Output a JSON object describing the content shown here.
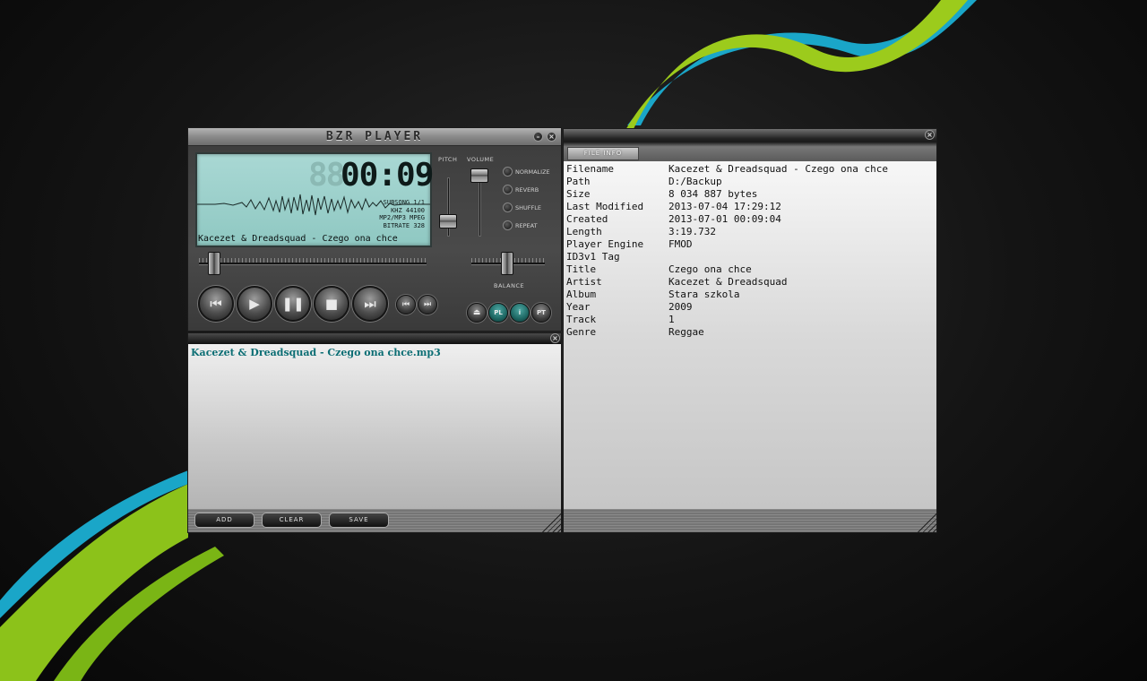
{
  "player": {
    "title": "BZR PLAYER",
    "lcd": {
      "time_ghost": "88",
      "time": "00:09",
      "info_lines": [
        "SUBSONG 1/1",
        "KHZ 44100",
        "MP2/MP3 MPEG",
        "BITRATE 328"
      ],
      "song": "Kacezet & Dreadsquad - Czego ona chce"
    },
    "labels": {
      "pitch": "PITCH",
      "volume": "VOLUME",
      "balance": "BALANCE"
    },
    "options": [
      "NORMALIZE",
      "REVERB",
      "SHUFFLE",
      "REPEAT"
    ],
    "small_buttons": {
      "playlist": "PL",
      "info": "i",
      "pt": "PT"
    }
  },
  "playlist": {
    "items": [
      "Kacezet & Dreadsquad - Czego ona chce.mp3"
    ],
    "buttons": {
      "add": "ADD",
      "clear": "CLEAR",
      "save": "SAVE"
    }
  },
  "file_info": {
    "tab": "FILE INFO",
    "rows": [
      {
        "key": "Filename",
        "value": "Kacezet & Dreadsquad - Czego ona chce"
      },
      {
        "key": "Path",
        "value": "D:/Backup"
      },
      {
        "key": "Size",
        "value": "8 034 887 bytes"
      },
      {
        "key": "Last Modified",
        "value": "2013-07-04 17:29:12"
      },
      {
        "key": "Created",
        "value": "2013-07-01 00:09:04"
      },
      {
        "key": "Length",
        "value": "3:19.732"
      },
      {
        "key": "Player Engine",
        "value": "FMOD"
      },
      {
        "key": "ID3v1 Tag",
        "value": ""
      },
      {
        "key": "Title",
        "value": "Czego ona chce"
      },
      {
        "key": "Artist",
        "value": "Kacezet & Dreadsquad"
      },
      {
        "key": "Album",
        "value": "Stara szkola"
      },
      {
        "key": "Year",
        "value": "2009"
      },
      {
        "key": "Track",
        "value": "1"
      },
      {
        "key": "Genre",
        "value": "Reggae"
      }
    ]
  },
  "colors": {
    "lcd": "#9fd3ce",
    "accent_teal": "#0c6e74",
    "swoosh_green": "#9ccb1c",
    "swoosh_blue": "#1aa6c8"
  }
}
